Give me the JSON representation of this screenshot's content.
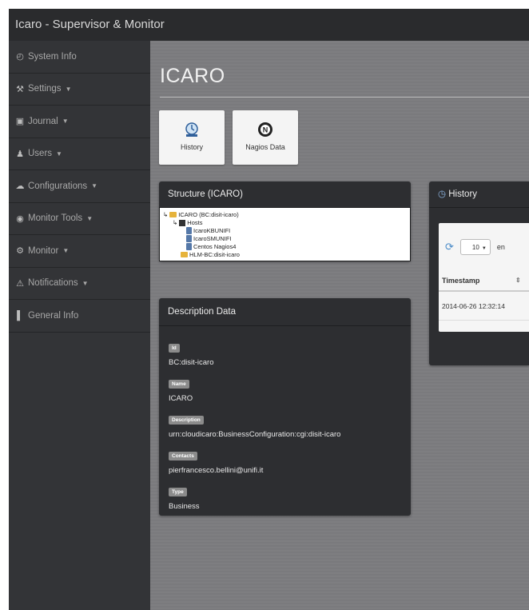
{
  "app": {
    "title": "Icaro - Supervisor & Monitor"
  },
  "sidebar": {
    "items": [
      {
        "label": "System Info",
        "icon": "clock-icon"
      },
      {
        "label": "Settings",
        "icon": "wrench-icon"
      },
      {
        "label": "Journal",
        "icon": "book-icon"
      },
      {
        "label": "Users",
        "icon": "user-icon"
      },
      {
        "label": "Configurations",
        "icon": "cloud-icon"
      },
      {
        "label": "Monitor Tools",
        "icon": "eye-icon"
      },
      {
        "label": "Monitor",
        "icon": "cog-icon"
      },
      {
        "label": "Notifications",
        "icon": "warning-icon"
      },
      {
        "label": "General Info",
        "icon": "bar-chart-icon"
      }
    ]
  },
  "main": {
    "page_title": "ICARO",
    "tiles": [
      {
        "label": "History",
        "icon": "history-icon"
      },
      {
        "label": "Nagios Data",
        "icon": "nagios-icon"
      }
    ]
  },
  "structure": {
    "title": "Structure (ICARO)",
    "tree": {
      "root": "ICARO (BC:disit-icaro)",
      "hosts": "Hosts",
      "host_items": [
        "IcaroKBUNIFI",
        "IcaroSMUNIFI",
        "Centos Nagios4"
      ],
      "hlm": "HLM-BC:disit-icaro"
    }
  },
  "description": {
    "title": "Description Data",
    "fields": [
      {
        "label": "Id",
        "value": "BC:disit-icaro"
      },
      {
        "label": "Name",
        "value": "ICARO"
      },
      {
        "label": "Description",
        "value": "urn:cloudicaro:BusinessConfiguration:cgi:disit-icaro"
      },
      {
        "label": "Contacts",
        "value": "pierfrancesco.bellini@unifi.it"
      },
      {
        "label": "Type",
        "value": "Business"
      }
    ]
  },
  "history": {
    "title": "History",
    "page_size": "10",
    "entries_text": "en",
    "column": "Timestamp",
    "rows": [
      "2014-06-26 12:32:14"
    ]
  }
}
